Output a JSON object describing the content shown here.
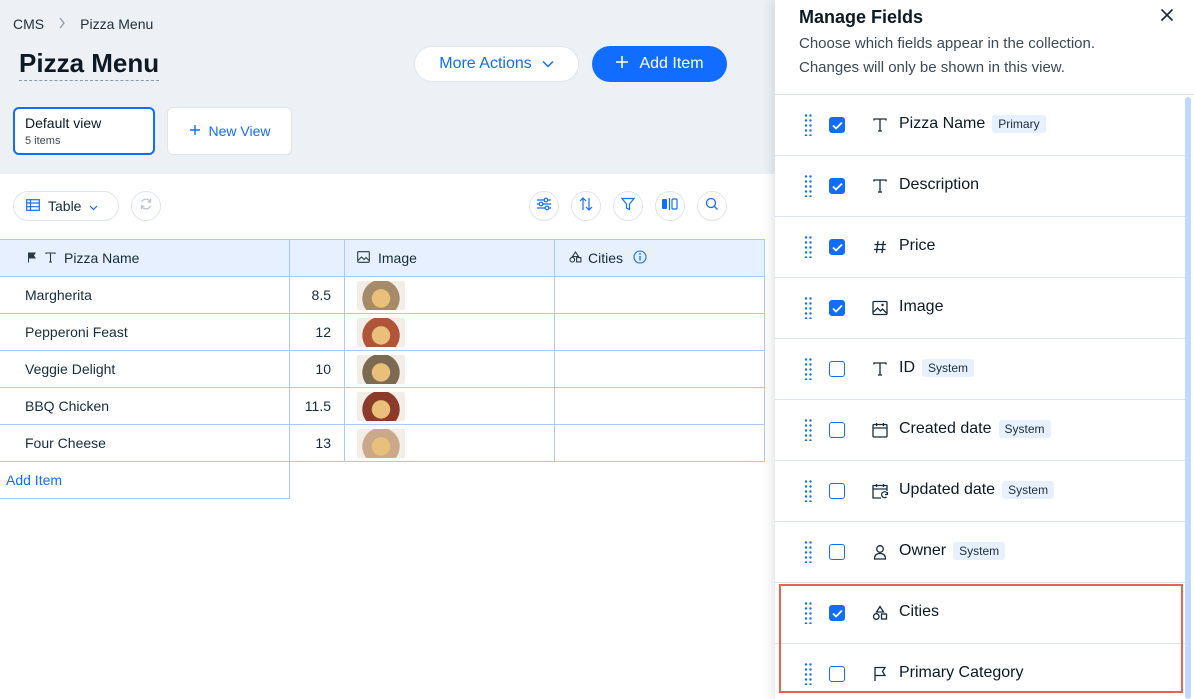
{
  "breadcrumb": [
    "CMS",
    "Pizza Menu"
  ],
  "page": {
    "title": "Pizza Menu",
    "more_actions_label": "More Actions",
    "add_item_label": "Add Item"
  },
  "views": {
    "current": {
      "name": "Default view",
      "count": "5 items"
    },
    "new_view_label": "New View"
  },
  "toolbar": {
    "layout_label": "Table"
  },
  "table": {
    "headers": {
      "name": "Pizza Name",
      "price": "",
      "image": "Image",
      "cities": "Cities"
    },
    "rows": [
      {
        "name": "Margherita",
        "price": "8.5",
        "thumb_color": "#a68b6b"
      },
      {
        "name": "Pepperoni Feast",
        "price": "12",
        "thumb_color": "#b0553a"
      },
      {
        "name": "Veggie Delight",
        "price": "10",
        "thumb_color": "#7d6a52"
      },
      {
        "name": "BBQ Chicken",
        "price": "11.5",
        "thumb_color": "#8c3a2a"
      },
      {
        "name": "Four Cheese",
        "price": "13",
        "thumb_color": "#c9a98a"
      }
    ],
    "add_item_label": "Add Item"
  },
  "panel": {
    "title": "Manage Fields",
    "description": "Choose which fields appear in the collection. Changes will only be shown in this view.",
    "fields": [
      {
        "name": "Pizza Name",
        "type": "text",
        "tag": "Primary",
        "checked": true
      },
      {
        "name": "Description",
        "type": "text",
        "tag": "",
        "checked": true
      },
      {
        "name": "Price",
        "type": "number",
        "tag": "",
        "checked": true
      },
      {
        "name": "Image",
        "type": "image",
        "tag": "",
        "checked": true
      },
      {
        "name": "ID",
        "type": "text",
        "tag": "System",
        "checked": false
      },
      {
        "name": "Created date",
        "type": "date",
        "tag": "System",
        "checked": false
      },
      {
        "name": "Updated date",
        "type": "date-updated",
        "tag": "System",
        "checked": false
      },
      {
        "name": "Owner",
        "type": "person",
        "tag": "System",
        "checked": false
      },
      {
        "name": "Cities",
        "type": "shapes",
        "tag": "",
        "checked": true
      },
      {
        "name": "Primary Category",
        "type": "flag",
        "tag": "",
        "checked": false
      }
    ]
  },
  "colors": {
    "accent": "#116dff",
    "highlight": "#e9624d",
    "header_bg": "#edf0f5"
  }
}
